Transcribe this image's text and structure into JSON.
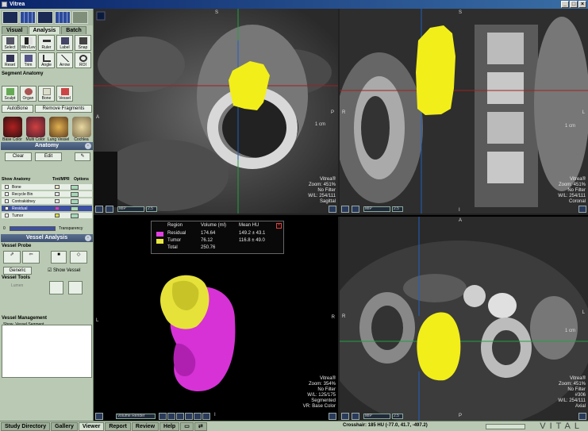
{
  "app": {
    "title": "Vitrea"
  },
  "left_panel": {
    "tabs": [
      "Visual",
      "Analysis",
      "Batch"
    ],
    "active_tab": "Analysis",
    "tools": [
      "Select",
      "Win/Lev",
      "Ruler",
      "Label",
      "Snap",
      "Reset",
      "Trim",
      "Angle",
      "Arrow",
      "ROI"
    ],
    "segment_anatomy_title": "Segment Anatomy",
    "segment_tools": [
      "Sculpt",
      "Organ",
      "Bone",
      "Vessel"
    ],
    "autobone": "AutoBone",
    "remove_fragments": "Remove Fragments",
    "presets": [
      "Base Color",
      "Multi Color",
      "Lung Vessel",
      "Cochlea"
    ],
    "anatomy": {
      "title": "Anatomy",
      "clear": "Clear",
      "edit": "Edit",
      "headers": [
        "Show",
        "Anatomy",
        "Tint/MPR",
        "Options"
      ],
      "rows": [
        {
          "name": "Bone",
          "color": "#f0e8c8",
          "selected": false
        },
        {
          "name": "Recycle Bin",
          "color": "#e8e8e8",
          "selected": false
        },
        {
          "name": "Contrakidney",
          "color": "#e8e8e8",
          "selected": false
        },
        {
          "name": "Residual",
          "color": "#e030e0",
          "selected": true
        },
        {
          "name": "Tumor",
          "color": "#e0e040",
          "selected": false
        }
      ],
      "transparency_label": "Transparency",
      "transparency_min": "0"
    },
    "vessel_analysis": {
      "title": "Vessel Analysis",
      "probe_title": "Vessel Probe",
      "generic": "Generic",
      "show_vessel": "Show Vessel",
      "tools_title": "Vessel Tools",
      "lumen": "Lumen",
      "management_title": "Vessel Management",
      "mgmt_headers": [
        "Show",
        "Vessel Segment"
      ]
    }
  },
  "views": {
    "sagittal": {
      "orient_top": "S",
      "orient_left": "A",
      "orient_right": "P",
      "orient_bottom": "I",
      "scale": "1 cm",
      "info": [
        "Vitrea®",
        "Zoom: 451%",
        "No Filter",
        "W/L: 254/111",
        "Sagittal"
      ],
      "mode": "MIP",
      "slab": "2.5"
    },
    "coronal": {
      "orient_top": "S",
      "orient_left": "R",
      "orient_right": "L",
      "orient_bottom": "I",
      "scale": "1 cm",
      "info": [
        "Vitrea®",
        "Zoom: 451%",
        "No Filter",
        "W/L: 254/111",
        "Coronal"
      ],
      "mode": "MIP",
      "slab": "2.5"
    },
    "volume": {
      "orient_left": "L",
      "orient_right": "R",
      "orient_bottom": "I",
      "info": [
        "Vitrea®",
        "Zoom: 354%",
        "No Filter",
        "W/L: 125/175",
        "Segmented",
        "VR: Base Color"
      ],
      "mode": "Volume Render",
      "legend": {
        "headers": [
          "Region",
          "Volume (ml)",
          "Mean HU"
        ],
        "rows": [
          {
            "region": "Residual",
            "volume": "174.64",
            "mean": "149.2 ± 43.1",
            "color": "#e040e0"
          },
          {
            "region": "Tumor",
            "volume": "76.12",
            "mean": "116.8 ± 49.0",
            "color": "#e8e840"
          },
          {
            "region": "Total",
            "volume": "250.76",
            "mean": "",
            "color": ""
          }
        ]
      }
    },
    "axial": {
      "orient_top": "A",
      "orient_left": "R",
      "orient_right": "L",
      "orient_bottom": "P",
      "scale": "1 cm",
      "info": [
        "Vitrea®",
        "Zoom: 451%",
        "No Filter",
        "#306",
        "W/L: 254/111",
        "Axial"
      ],
      "mode": "MIP",
      "slab": "2.5"
    }
  },
  "bottom_tabs": [
    "Study Directory",
    "Gallery",
    "Viewer",
    "Report",
    "Review",
    "Help"
  ],
  "active_bottom_tab": "Viewer",
  "status": {
    "crosshair": "Crosshair: 185 HU (-77.0, 41.7, -497.2)"
  },
  "brand": "VITAL"
}
